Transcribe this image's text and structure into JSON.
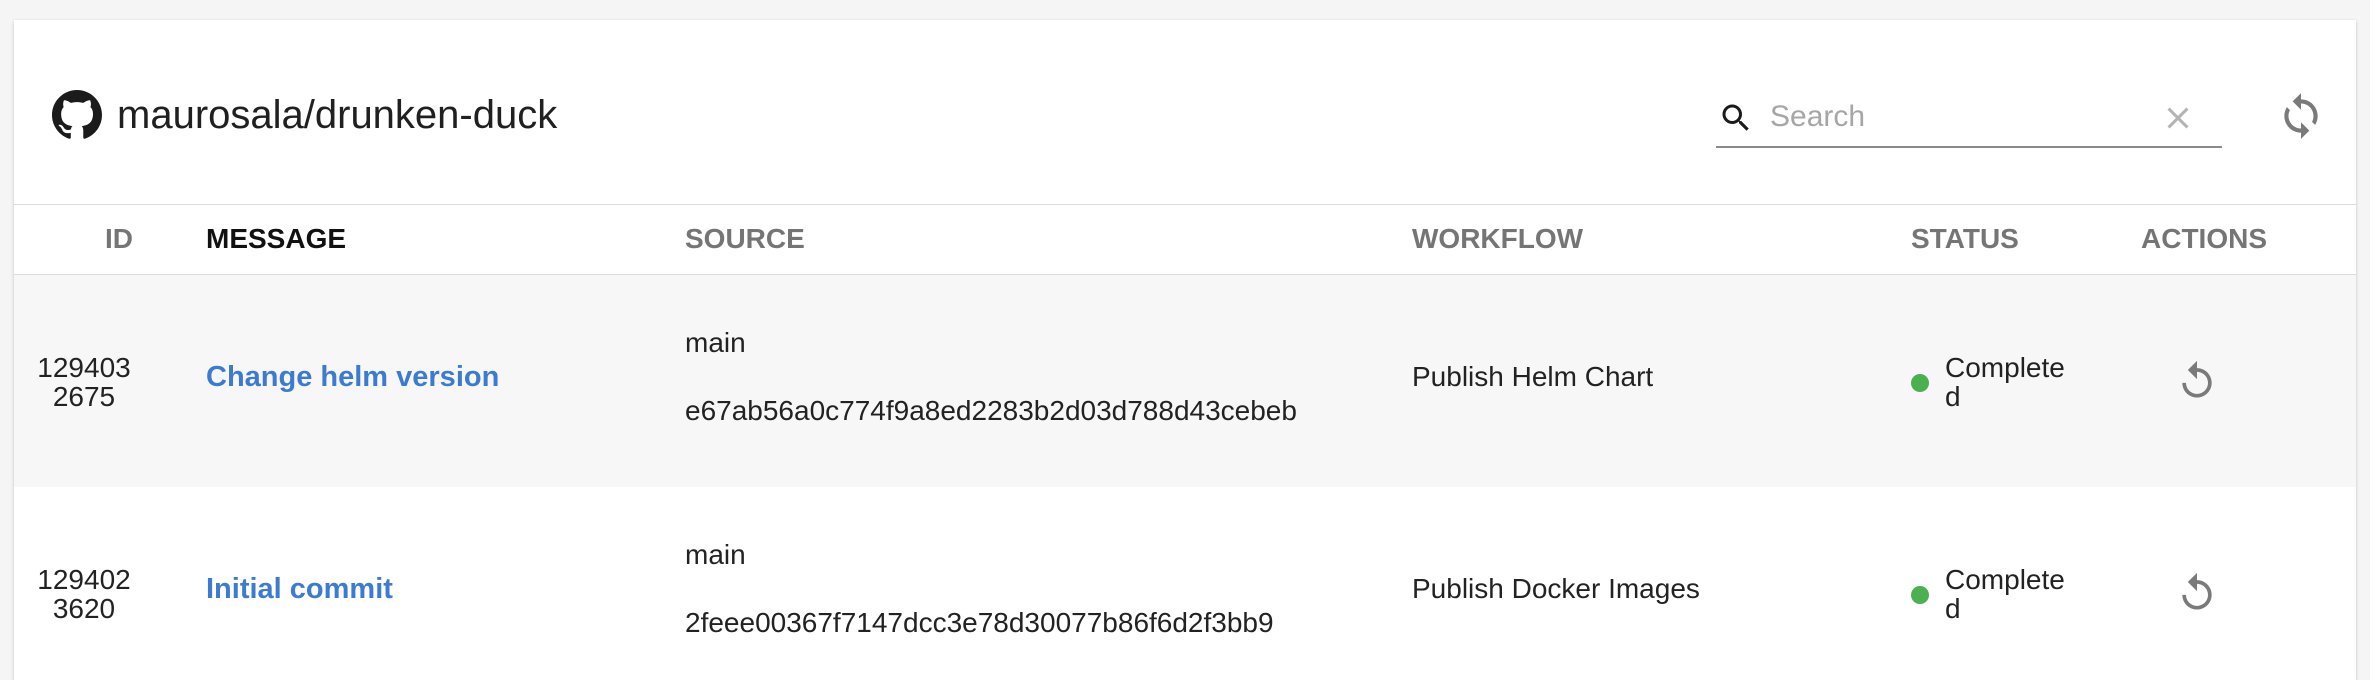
{
  "header": {
    "repo": "maurosala/drunken-duck",
    "search_placeholder": "Search",
    "search_value": ""
  },
  "columns": {
    "id": "ID",
    "message": "MESSAGE",
    "source": "SOURCE",
    "workflow": "WORKFLOW",
    "status": "STATUS",
    "actions": "ACTIONS"
  },
  "rows": [
    {
      "id": "1294032675",
      "message": "Change helm version",
      "branch": "main",
      "sha": "e67ab56a0c774f9a8ed2283b2d03d788d43cebeb",
      "workflow": "Publish Helm Chart",
      "status": "Completed"
    },
    {
      "id": "1294023620",
      "message": "Initial commit",
      "branch": "main",
      "sha": "2feee00367f7147dcc3e78d30077b86f6d2f3bb9",
      "workflow": "Publish Docker Images",
      "status": "Completed"
    }
  ],
  "icons": {
    "repo": "github-icon",
    "search": "search-icon",
    "clear": "close-icon",
    "refresh": "refresh-icon",
    "retry": "retry-icon"
  },
  "colors": {
    "link": "#3d7bd0",
    "status_completed": "#4caf50",
    "row_alt": "#f7f7f7"
  }
}
